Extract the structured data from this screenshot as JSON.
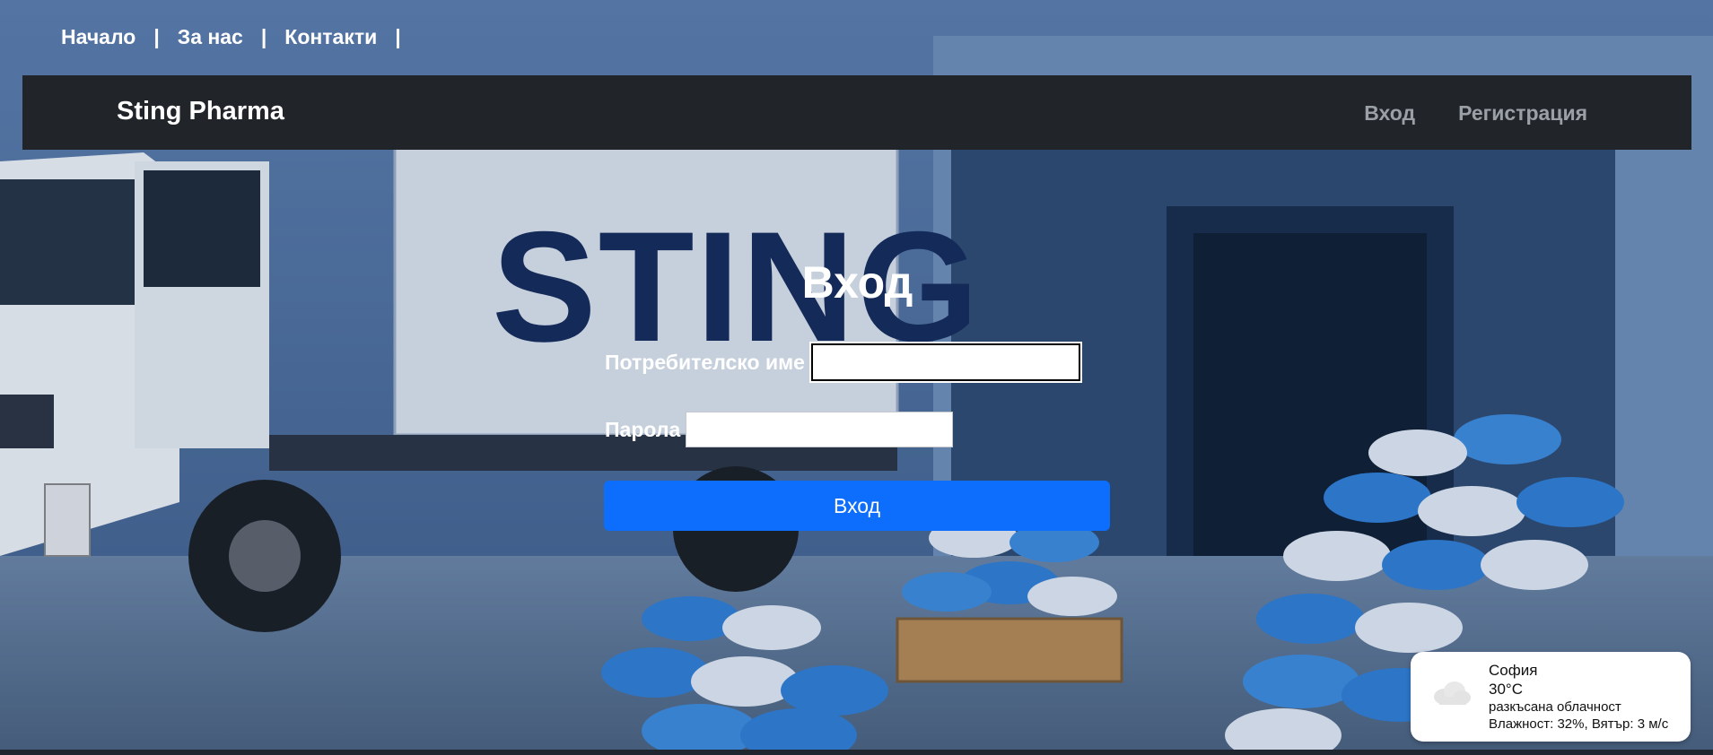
{
  "top_links": [
    {
      "label": "Начало"
    },
    {
      "label": "За нас"
    },
    {
      "label": "Контакти"
    }
  ],
  "separator": "|",
  "navbar": {
    "brand": "Sting Pharma",
    "links": [
      {
        "label": "Вход"
      },
      {
        "label": "Регистрация"
      }
    ]
  },
  "background": {
    "truck_text": "STING",
    "icons": [
      "delivery-truck",
      "warehouse",
      "capsule-piles",
      "pallet"
    ]
  },
  "login": {
    "title": "Вход",
    "username_label": "Потребителско име",
    "username_value": "",
    "password_label": "Парола",
    "password_value": "",
    "submit_label": "Вход"
  },
  "weather": {
    "icon": "cloud-icon",
    "city": "София",
    "temperature": "30°C",
    "description": "разкъсана облачност",
    "details": "Влажност: 32%, Вятър: 3 м/с"
  },
  "colors": {
    "navbar_bg": "#212529",
    "primary_button": "#0d6efd",
    "nav_link": "#9aa0a6"
  }
}
